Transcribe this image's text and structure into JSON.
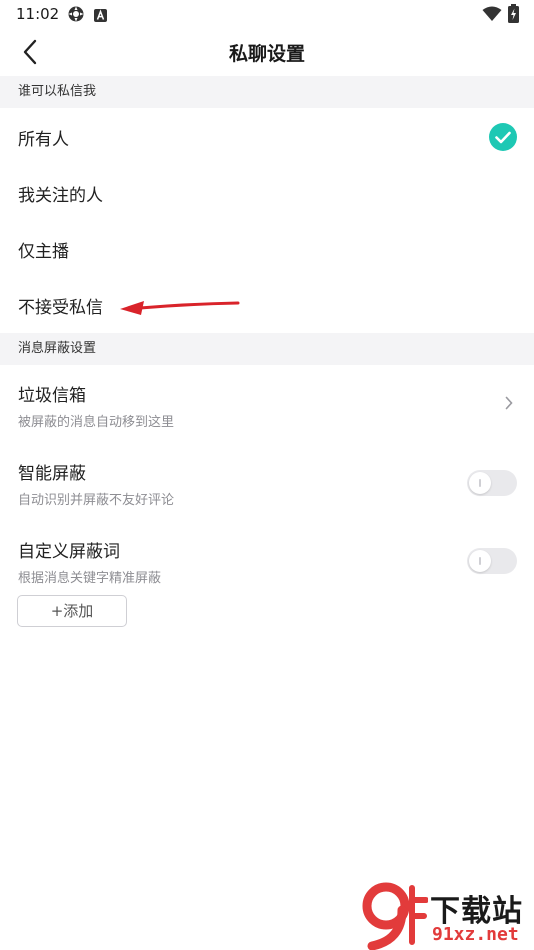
{
  "status_bar": {
    "time": "11:02",
    "icons": [
      "sync-icon",
      "text-a-icon",
      "wifi-icon",
      "battery-icon"
    ]
  },
  "nav": {
    "back_icon": "chevron-left-icon",
    "title": "私聊设置"
  },
  "dm_section": {
    "header": "谁可以私信我",
    "options": [
      {
        "label": "所有人",
        "selected": true
      },
      {
        "label": "我关注的人",
        "selected": false
      },
      {
        "label": "仅主播",
        "selected": false
      },
      {
        "label": "不接受私信",
        "selected": false
      }
    ],
    "check_color": "#1ec8b4"
  },
  "filter_section": {
    "header": "消息屏蔽设置",
    "spam_box": {
      "title": "垃圾信箱",
      "desc": "被屏蔽的消息自动移到这里",
      "icon": "chevron-right-icon"
    },
    "smart_block": {
      "title": "智能屏蔽",
      "desc": "自动识别并屏蔽不友好评论",
      "enabled": false
    },
    "custom_words": {
      "title": "自定义屏蔽词",
      "desc": "根据消息关键字精准屏蔽",
      "enabled": false
    },
    "add_button": "+添加"
  },
  "annotation": {
    "arrow_color": "#d9232a"
  },
  "watermark": {
    "logo": "9f-logo",
    "text": "下载站",
    "url": "91xz.net",
    "color": "#e23b3b"
  }
}
